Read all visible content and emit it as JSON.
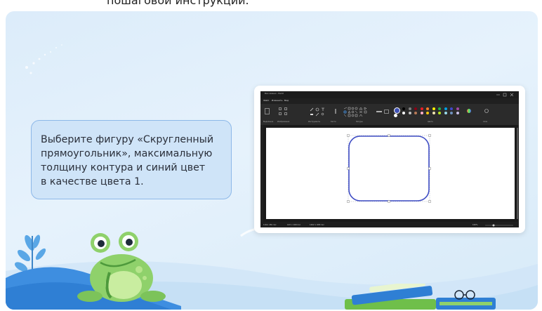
{
  "page": {
    "top_caption": "пошаговой инструкции."
  },
  "instruction": {
    "lines": [
      "Выберите фигуру «Скругленный",
      "прямоугольник», максимальную",
      "толщину контура и синий цвет",
      "в качестве цвета 1."
    ]
  },
  "paint": {
    "title": "Без имени - Paint",
    "menu": [
      "Файл",
      "Изменить",
      "Вид"
    ],
    "ribbon_groups": [
      "Выделение",
      "Изображение",
      "Инструменты",
      "Кисти",
      "Фигуры",
      "Цвета",
      "Слои"
    ],
    "status": {
      "cursor": "1102, 281 пкс",
      "selection": "143 × 160 пкс",
      "canvas_size": "1262 × 683 пкс",
      "zoom": "100%"
    },
    "colors": {
      "accent_blue": "#3f51b5",
      "shape_outline": "#3f4dc4"
    },
    "palette": [
      "#000000",
      "#7f7f7f",
      "#880015",
      "#ed1c24",
      "#ff7f27",
      "#fff200",
      "#22b14c",
      "#00a2e8",
      "#3f48cc",
      "#a349a4",
      "#ffffff",
      "#c3c3c3",
      "#b97a57",
      "#ffaec9",
      "#ffc90e",
      "#efe4b0",
      "#b5e61d",
      "#99d9ea",
      "#7092be",
      "#c8bfe7"
    ]
  },
  "illustration": {
    "frog": "frog-mascot",
    "books": "books-with-glasses",
    "plant": "plant-leaves"
  }
}
